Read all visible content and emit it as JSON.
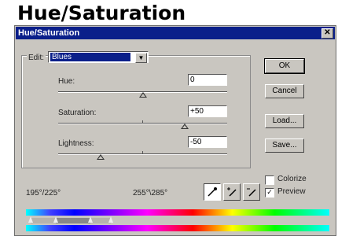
{
  "page": {
    "heading": "Hue/Saturation"
  },
  "dialog": {
    "title": "Hue/Saturation",
    "close_glyph": "✕",
    "edit": {
      "label": "Edit:",
      "value": "Blues"
    },
    "sliders": [
      {
        "label": "Hue:",
        "value": "0",
        "position": 0.5
      },
      {
        "label": "Saturation:",
        "value": "+50",
        "position": 0.75
      },
      {
        "label": "Lightness:",
        "value": "-50",
        "position": 0.25
      }
    ],
    "buttons": {
      "ok": "OK",
      "cancel": "Cancel",
      "load": "Load...",
      "save": "Save..."
    },
    "colorize": {
      "label": "Colorize",
      "checked": false
    },
    "preview": {
      "label": "Preview",
      "checked": true,
      "mark": "✓"
    },
    "range_left": "195°/225°",
    "range_right": "255°\\285°",
    "tools": [
      "eyedropper-icon",
      "eyedropper-plus-icon",
      "eyedropper-minus-icon"
    ]
  }
}
